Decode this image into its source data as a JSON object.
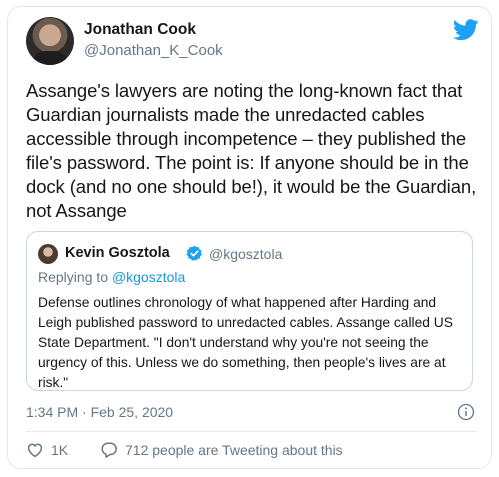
{
  "author": {
    "name": "Jonathan Cook",
    "handle": "@Jonathan_K_Cook"
  },
  "tweet_text": "Assange's lawyers are noting the long-known fact that Guardian journalists made the unredacted cables accessible through incompetence – they published the file's password. The point is: If anyone should be in the dock (and no one should be!), it would be the Guardian, not Assange",
  "quoted": {
    "name": "Kevin Gosztola",
    "handle": "@kgosztola",
    "replying_prefix": "Replying to ",
    "replying_to": "@kgosztola",
    "text": "Defense outlines chronology of what happened after Harding and Leigh published password to unredacted cables. Assange called US State Department. \"I don't understand why you're not seeing the urgency of this. Unless we do something, then people's lives are at risk.\""
  },
  "timestamp": "1:34 PM · Feb 25, 2020",
  "stats": {
    "likes": "1K",
    "retweet_text": "712 people are Tweeting about this"
  },
  "icons": {
    "logo": "twitter-bird-icon",
    "verified": "verified-badge-icon",
    "info": "info-icon",
    "like": "heart-icon",
    "reply": "speech-bubble-icon"
  },
  "colors": {
    "brand": "#1da1f2",
    "link": "#1b95e0",
    "muted": "#657786"
  }
}
